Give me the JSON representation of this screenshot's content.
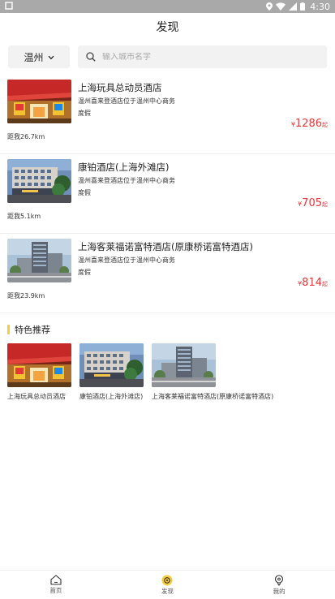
{
  "status_bar": {
    "time": "4:30",
    "icons": [
      "notification-icon",
      "location-icon",
      "wifi-icon",
      "signal-icon",
      "battery-icon"
    ]
  },
  "header": {
    "title": "发现"
  },
  "search": {
    "city": "温州",
    "placeholder": "输入城市名字"
  },
  "hotels": [
    {
      "name": "上海玩具总动员酒店",
      "desc": "温州喜来登酒店位于温州中心商务",
      "tag": "度假",
      "price_symbol": "¥",
      "price": "1286",
      "price_suffix": "起",
      "distance": "距我26.7km",
      "image": "hotel-red-lobby"
    },
    {
      "name": "康铂酒店(上海外滩店)",
      "desc": "温州喜来登酒店位于温州中心商务",
      "tag": "度假",
      "price_symbol": "¥",
      "price": "705",
      "price_suffix": "起",
      "distance": "距我5.1km",
      "image": "hotel-building-street"
    },
    {
      "name": "上海客莱福诺富特酒店(原康桥诺富特酒店)",
      "desc": "温州喜来登酒店位于温州中心商务",
      "tag": "度假",
      "price_symbol": "¥",
      "price": "814",
      "price_suffix": "起",
      "distance": "距我23.9km",
      "image": "hotel-tower-exterior"
    }
  ],
  "featured": {
    "title": "特色推荐",
    "items": [
      {
        "name": "上海玩具总动员酒店",
        "image": "hotel-red-lobby"
      },
      {
        "name": "康铂酒店(上海外滩店)",
        "image": "hotel-building-street"
      },
      {
        "name": "上海客莱福诺富特酒店(原康桥诺富特酒店)",
        "image": "hotel-tower-exterior"
      }
    ]
  },
  "tabs": [
    {
      "label": "首页",
      "icon": "home-icon"
    },
    {
      "label": "发现",
      "icon": "discover-icon",
      "active": true
    },
    {
      "label": "我的",
      "icon": "profile-icon"
    }
  ],
  "colors": {
    "price": "#e8383d",
    "accent": "#f5cc3e",
    "statusbar": "#a9a9a9",
    "input_bg": "#f2f2f2"
  }
}
